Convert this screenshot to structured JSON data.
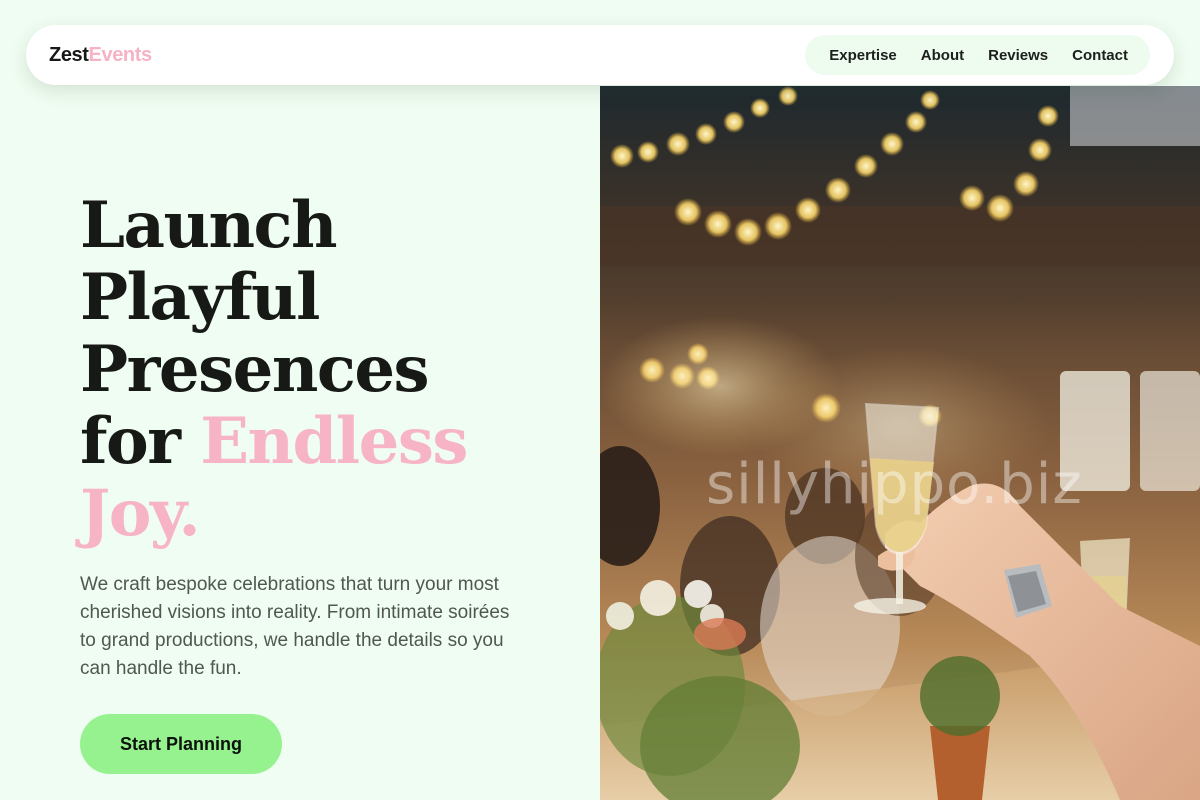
{
  "header": {
    "logo_first": "Zest",
    "logo_second": "Events",
    "nav": [
      {
        "label": "Expertise"
      },
      {
        "label": "About"
      },
      {
        "label": "Reviews"
      },
      {
        "label": "Contact"
      }
    ]
  },
  "hero": {
    "title_line1": "Launch",
    "title_line2": "Playful",
    "title_line3": "Presences",
    "title_line4_plain": "for",
    "title_line4_accent": "Endless",
    "title_line5_accent": "Joy.",
    "description": "We craft bespoke celebrations that turn your most cherished visions into reality. From intimate soirées to grand productions, we handle the details so you can handle the fun.",
    "cta_label": "Start Planning",
    "image_watermark": "sillyhippo.biz"
  },
  "colors": {
    "background": "#f0fdf2",
    "accent_pink": "#f6b4c6",
    "cta_green": "#95f28f",
    "nav_pill": "#eefbef"
  }
}
